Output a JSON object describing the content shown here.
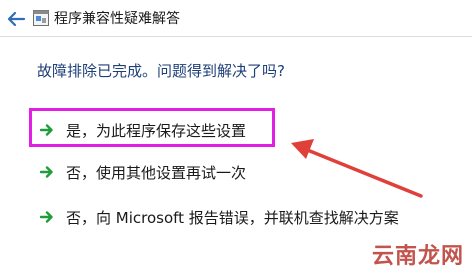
{
  "window": {
    "title": "程序兼容性疑难解答",
    "back_icon": "back-arrow-icon",
    "app_icon": "compatibility-troubleshooter-icon"
  },
  "main": {
    "question": "故障排除已完成。问题得到解决了吗?",
    "options": [
      {
        "label": "是，为此程序保存这些设置",
        "icon": "green-arrow-icon",
        "highlighted": true
      },
      {
        "label": "否，使用其他设置再试一次",
        "icon": "green-arrow-icon"
      },
      {
        "label": "否，向 Microsoft 报告错误，并联机查找解决方案",
        "icon": "green-arrow-icon"
      }
    ]
  },
  "annotation": {
    "highlight_color": "#e21fe5",
    "arrow_color": "#e0403a"
  },
  "watermark": {
    "text": "云南龙网"
  }
}
